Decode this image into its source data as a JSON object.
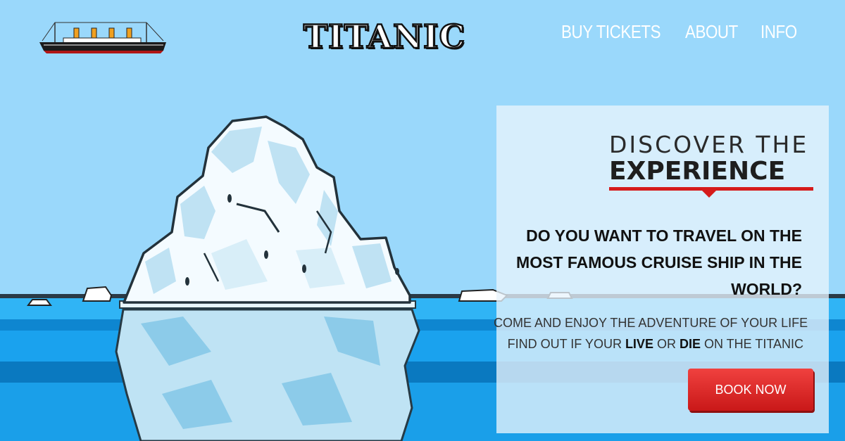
{
  "header": {
    "title": "TITANIC",
    "nav": [
      {
        "label": "BUY TICKETS"
      },
      {
        "label": "ABOUT"
      },
      {
        "label": "INFO"
      }
    ]
  },
  "card": {
    "discover_line1": "DISCOVER THE",
    "discover_line2": "EXPERIENCE",
    "question": "DO YOU WANT TO TRAVEL ON THE MOST FAMOUS CRUISE SHIP IN THE WORLD?",
    "subline1": "COME AND ENJOY THE ADVENTURE OF YOUR LIFE",
    "subline2_pre": "FIND OUT IF YOUR ",
    "subline2_live": "LIVE",
    "subline2_mid": " OR ",
    "subline2_die": "DIE",
    "subline2_post": " ON THE TITANIC",
    "button": "BOOK NOW"
  },
  "colors": {
    "sky": "#9ad8fb",
    "water": "#1aa4f2",
    "accent_red": "#d51b1b"
  },
  "icons": {
    "logo": "ship-icon",
    "background": "iceberg-illustration"
  }
}
